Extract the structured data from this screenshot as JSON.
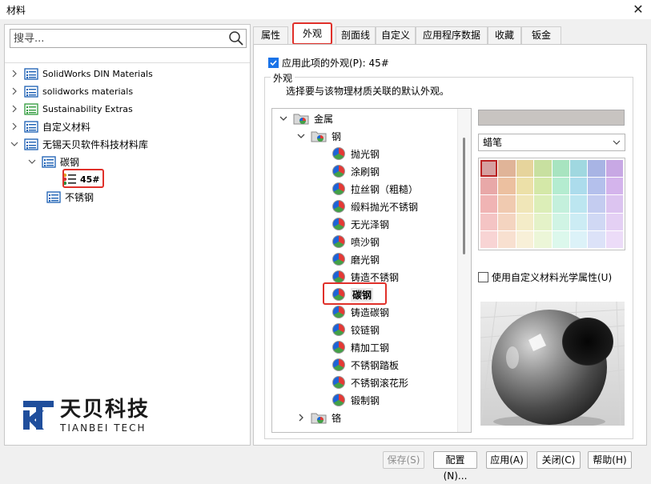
{
  "window": {
    "title": "材料",
    "close_glyph": "✕"
  },
  "search": {
    "placeholder": "搜寻..."
  },
  "tree": [
    {
      "label": "SolidWorks DIN Materials",
      "expanded": false,
      "icon": "library-icon"
    },
    {
      "label": "solidworks materials",
      "expanded": false,
      "icon": "library-icon"
    },
    {
      "label": "Sustainability Extras",
      "expanded": false,
      "icon": "green-library-icon"
    },
    {
      "label": "自定义材料",
      "expanded": false,
      "icon": "library-icon"
    },
    {
      "label": "无锡天贝软件科技材料库",
      "expanded": true,
      "icon": "library-icon",
      "children": [
        {
          "label": "碳钢",
          "expanded": true,
          "children": [
            {
              "label": "45#",
              "selected": true
            }
          ]
        },
        {
          "label": "不锈钢"
        }
      ]
    }
  ],
  "logo": {
    "cn": "天贝科技",
    "en": "TIANBEI TECH"
  },
  "tabs": [
    {
      "label": "属性",
      "active": false
    },
    {
      "label": "外观",
      "active": true
    },
    {
      "label": "剖面线",
      "active": false
    },
    {
      "label": "自定义",
      "active": false
    },
    {
      "label": "应用程序数据",
      "active": false
    },
    {
      "label": "收藏",
      "active": false
    },
    {
      "label": "钣金",
      "active": false
    }
  ],
  "apply_checkbox": {
    "label": "应用此项的外观(P): 45#",
    "checked": true
  },
  "group": {
    "title": "外观",
    "description": "选择要与该物理材质关联的默认外观。"
  },
  "appearance_tree": {
    "root": "金属",
    "steel": "钢",
    "items": [
      "抛光钢",
      "涂刷钢",
      "拉丝钢（粗糙）",
      "缎料抛光不锈钢",
      "无光泽钢",
      "喷沙钢",
      "磨光钢",
      "铸造不锈钢",
      "碳钢",
      "铸造碳钢",
      "铰链钢",
      "精加工钢",
      "不锈钢踏板",
      "不锈钢滚花形",
      "锻制钢"
    ],
    "selected": "碳钢",
    "next_folder": "铬"
  },
  "color_preview": "#c8c4c1",
  "dropdown": {
    "selected": "蜡笔"
  },
  "palette": [
    [
      "#d6a0a0",
      "#e0b498",
      "#e6d49c",
      "#c8e0a0",
      "#a8e4c0",
      "#a0d8e0",
      "#a8b4e4",
      "#c8a8e4"
    ],
    [
      "#e8a8a8",
      "#ecc0a0",
      "#ece0a8",
      "#d4e8a8",
      "#b4ecd0",
      "#acdcec",
      "#b4c0ec",
      "#d4b4ec"
    ],
    [
      "#f0b4b4",
      "#f0cab0",
      "#f0e6b8",
      "#dceeb8",
      "#c4f0dc",
      "#bce6f0",
      "#c4ccf0",
      "#dcc4f0"
    ],
    [
      "#f4c4c4",
      "#f4d4c0",
      "#f4ecc8",
      "#e4f2c8",
      "#d0f4e4",
      "#ccecf4",
      "#d0d8f4",
      "#e4d0f4"
    ],
    [
      "#f8d4d4",
      "#f8e0d0",
      "#f8f0d8",
      "#ecf6d8",
      "#dcf8ec",
      "#dcf2f8",
      "#dce2f8",
      "#ecdcf8"
    ]
  ],
  "custom_optical": {
    "label": "使用自定义材料光学属性(U)",
    "checked": false
  },
  "buttons": {
    "save": "保存(S)",
    "config": "配置(N)...",
    "apply": "应用(A)",
    "close": "关闭(C)",
    "help": "帮助(H)"
  },
  "colors": {
    "highlight_red": "#e0302a",
    "check_blue": "#1a73e8",
    "logo_blue": "#1f4e9c"
  }
}
